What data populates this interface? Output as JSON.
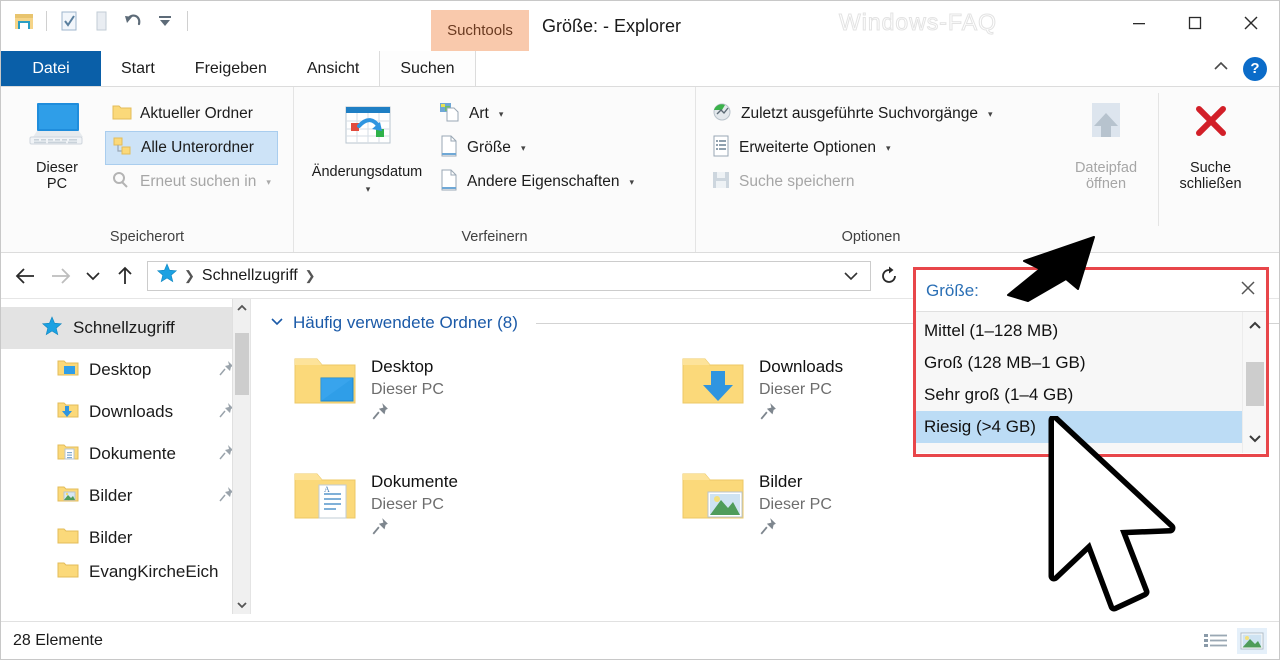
{
  "window": {
    "title": "Größe: - Explorer",
    "watermark": "Windows-FAQ",
    "contextual_tab_group": "Suchtools",
    "minimize": "—",
    "maximize": "□",
    "close": "✕"
  },
  "quick_access_toolbar": {
    "items": [
      {
        "name": "save-folder-icon",
        "label": ""
      },
      {
        "name": "properties-icon",
        "label": ""
      },
      {
        "name": "new-folder-icon",
        "label": ""
      },
      {
        "name": "undo-icon",
        "label": ""
      },
      {
        "name": "customize-qat-icon",
        "label": ""
      }
    ]
  },
  "ribbon": {
    "tabs": [
      {
        "label": "Datei",
        "active": false,
        "style": "file"
      },
      {
        "label": "Start",
        "active": false
      },
      {
        "label": "Freigeben",
        "active": false
      },
      {
        "label": "Ansicht",
        "active": false
      },
      {
        "label": "Suchen",
        "active": true
      }
    ],
    "collapse_label": "⌃",
    "help_label": "?",
    "groups": [
      {
        "title": "Speicherort",
        "big_button": {
          "label_line1": "Dieser",
          "label_line2": "PC",
          "icon": "this-pc-icon"
        },
        "small_buttons": [
          {
            "label": "Aktueller Ordner",
            "icon": "folder-icon",
            "selected": false,
            "disabled": false,
            "caret": false
          },
          {
            "label": "Alle Unterordner",
            "icon": "subfolders-icon",
            "selected": true,
            "disabled": false,
            "caret": false
          },
          {
            "label": "Erneut suchen in",
            "icon": "search-again-icon",
            "selected": false,
            "disabled": true,
            "caret": true
          }
        ]
      },
      {
        "title": "Verfeinern",
        "big_button": {
          "label_line1": "Änderungsdatum",
          "label_line2": "",
          "icon": "calendar-icon",
          "caret": true
        },
        "small_buttons": [
          {
            "label": "Art",
            "icon": "kind-icon",
            "selected": false,
            "disabled": false,
            "caret": true
          },
          {
            "label": "Größe",
            "icon": "size-icon",
            "selected": false,
            "disabled": false,
            "caret": true
          },
          {
            "label": "Andere Eigenschaften",
            "icon": "other-properties-icon",
            "selected": false,
            "disabled": false,
            "caret": true
          }
        ]
      },
      {
        "title": "Optionen",
        "small_buttons": [
          {
            "label": "Zuletzt ausgeführte Suchvorgänge",
            "icon": "recent-searches-icon",
            "selected": false,
            "disabled": false,
            "caret": true
          },
          {
            "label": "Erweiterte Optionen",
            "icon": "advanced-options-icon",
            "selected": false,
            "disabled": false,
            "caret": true
          },
          {
            "label": "Suche speichern",
            "icon": "save-search-icon",
            "selected": false,
            "disabled": true,
            "caret": false
          }
        ],
        "extra_big_buttons": [
          {
            "label_line1": "Dateipfad",
            "label_line2": "öffnen",
            "icon": "open-file-path-icon",
            "disabled": true
          },
          {
            "label_line1": "Suche",
            "label_line2": "schließen",
            "icon": "close-search-icon",
            "disabled": false
          }
        ]
      }
    ]
  },
  "address_bar": {
    "back": "←",
    "forward": "→",
    "recent": "⌄",
    "up": "↑",
    "crumbs": [
      "Schnellzugriff"
    ],
    "crumb_sep": "❯",
    "dropdown": "⌄",
    "refresh": "↻"
  },
  "search": {
    "label": "Größe:",
    "clear": "✕",
    "options": [
      {
        "label": "Mittel (1–128 MB)",
        "selected": false
      },
      {
        "label": "Groß (128 MB–1 GB)",
        "selected": false
      },
      {
        "label": "Sehr groß (1–4 GB)",
        "selected": false
      },
      {
        "label": "Riesig (>4 GB)",
        "selected": true
      }
    ],
    "scroll_up": "⌃",
    "scroll_down": "⌄"
  },
  "nav_pane": {
    "items": [
      {
        "label": "Schnellzugriff",
        "icon": "star-icon",
        "level": "root",
        "pinned": false,
        "selected": true
      },
      {
        "label": "Desktop",
        "icon": "desktop-folder-icon",
        "level": "child",
        "pinned": true
      },
      {
        "label": "Downloads",
        "icon": "downloads-folder-icon",
        "level": "child",
        "pinned": true
      },
      {
        "label": "Dokumente",
        "icon": "documents-folder-icon",
        "level": "child",
        "pinned": true
      },
      {
        "label": "Bilder",
        "icon": "pictures-folder-icon",
        "level": "child",
        "pinned": true
      },
      {
        "label": "Bilder",
        "icon": "folder-icon",
        "level": "child",
        "pinned": false
      },
      {
        "label": "EvangKircheEich",
        "icon": "folder-icon",
        "level": "child",
        "pinned": false
      }
    ],
    "scroll_up": "⌃",
    "scroll_down": "⌄"
  },
  "content": {
    "group_header": "Häufig verwendete Ordner (8)",
    "group_chevron": "⌄",
    "tiles": [
      {
        "name": "Desktop",
        "sub": "Dieser PC",
        "icon": "desktop-folder-icon",
        "pinned": true
      },
      {
        "name": "Downloads",
        "sub": "Dieser PC",
        "icon": "downloads-folder-icon",
        "pinned": true
      },
      {
        "name": "Dokumente",
        "sub": "Dieser PC",
        "icon": "documents-folder-icon",
        "pinned": true
      },
      {
        "name": "Bilder",
        "sub": "Dieser PC",
        "icon": "pictures-folder-icon",
        "pinned": true
      }
    ]
  },
  "status_bar": {
    "item_count": "28 Elemente",
    "views": [
      {
        "name": "details-view-icon",
        "active": false
      },
      {
        "name": "large-icons-view-icon",
        "active": true
      }
    ]
  },
  "colors": {
    "accent": "#0a5fa8",
    "contextual_tab": "#f9c9ac",
    "highlight_red": "#e8464a",
    "selection_blue": "#bcdcf5",
    "link_blue": "#1b5aa8"
  }
}
